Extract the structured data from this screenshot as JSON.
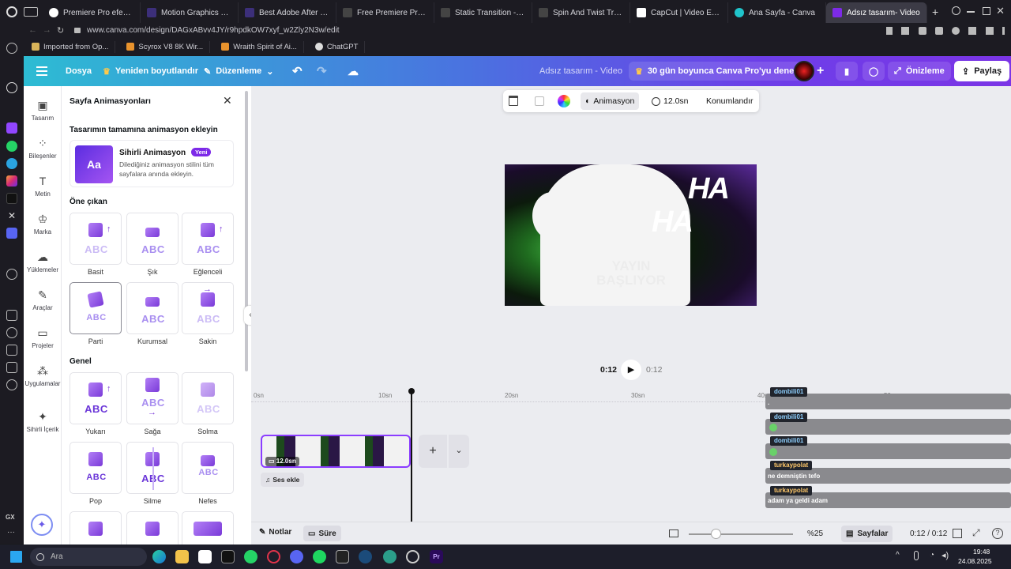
{
  "browser": {
    "tabs": [
      {
        "label": "Premiere Pro efekt kayn"
      },
      {
        "label": "Motion Graphics Templ"
      },
      {
        "label": "Best Adobe After Effects"
      },
      {
        "label": "Free Premiere Pro Trans"
      },
      {
        "label": "Static Transition - Free"
      },
      {
        "label": "Spin And Twist Transitio"
      },
      {
        "label": "CapCut | Video Editor |"
      },
      {
        "label": "Ana Sayfa - Canva"
      },
      {
        "label": "Adsız tasarım- Video"
      }
    ],
    "url": "www.canva.com/design/DAGxABvv4JY/r9hpdkOW7xyf_w2Zly2N3w/edit",
    "bookmarks": [
      "Imported from Op...",
      "Scyrox V8 8K Wir...",
      "Wraith Spirit of Ai...",
      "ChatGPT"
    ]
  },
  "header": {
    "file": "Dosya",
    "resize": "Yeniden boyutlandır",
    "edit": "Düzenleme",
    "title": "Adsız tasarım - Video",
    "promo": "30 gün boyunca Canva Pro'yu deneyin",
    "preview": "Önizleme",
    "share": "Paylaş"
  },
  "rail": {
    "items": [
      "Tasarım",
      "Bileşenler",
      "Metin",
      "Marka",
      "Yüklemeler",
      "Araçlar",
      "Projeler",
      "Uygulamalar",
      "Sihirli İçerik"
    ]
  },
  "panel": {
    "title": "Sayfa Animasyonları",
    "section_all": "Tasarımın tamamına animasyon ekleyin",
    "magic_title": "Sihirli Animasyon",
    "magic_badge": "Yeni",
    "magic_desc": "Dilediğiniz animasyon stilini tüm sayfalara anında ekleyin.",
    "featured_title": "Öne çıkan",
    "featured": [
      "Basit",
      "Şık",
      "Eğlenceli",
      "Parti",
      "Kurumsal",
      "Sakin"
    ],
    "general_title": "Genel",
    "general": [
      "Yukarı",
      "Sağa",
      "Solma",
      "Pop",
      "Silme",
      "Nefes"
    ],
    "abc": "ABC"
  },
  "toolbar": {
    "animation": "Animasyon",
    "duration": "12.0sn",
    "position": "Konumlandır"
  },
  "canvas": {
    "ha1": "HA",
    "ha2": "HA",
    "overlay": "YAYIN BAŞLIYOR"
  },
  "player": {
    "current": "0:12",
    "total": "0:12"
  },
  "timeline": {
    "ticks": [
      "0sn",
      "10sn",
      "20sn",
      "30sn",
      "40sn",
      "50sn"
    ],
    "clip_duration": "12.0sn",
    "add_audio": "Ses ekle"
  },
  "chat": [
    {
      "user": "dombili01",
      "text": "."
    },
    {
      "user": "dombili01",
      "text": ""
    },
    {
      "user": "dombili01",
      "text": ""
    },
    {
      "user": "turkaypolat",
      "text": "ne demniştin tefo"
    },
    {
      "user": "turkaypolat",
      "text": "adam ya geldi adam"
    }
  ],
  "bottom": {
    "notes": "Notlar",
    "duration": "Süre",
    "zoom": "%25",
    "pages": "Sayfalar",
    "time": "0:12 / 0:12"
  },
  "taskbar": {
    "search": "Ara",
    "time": "19:48",
    "date": "24.08.2025"
  },
  "colors": {
    "accent": "#7d2ae8",
    "header_start": "#2dbcd3",
    "header_end": "#7b35e6"
  }
}
